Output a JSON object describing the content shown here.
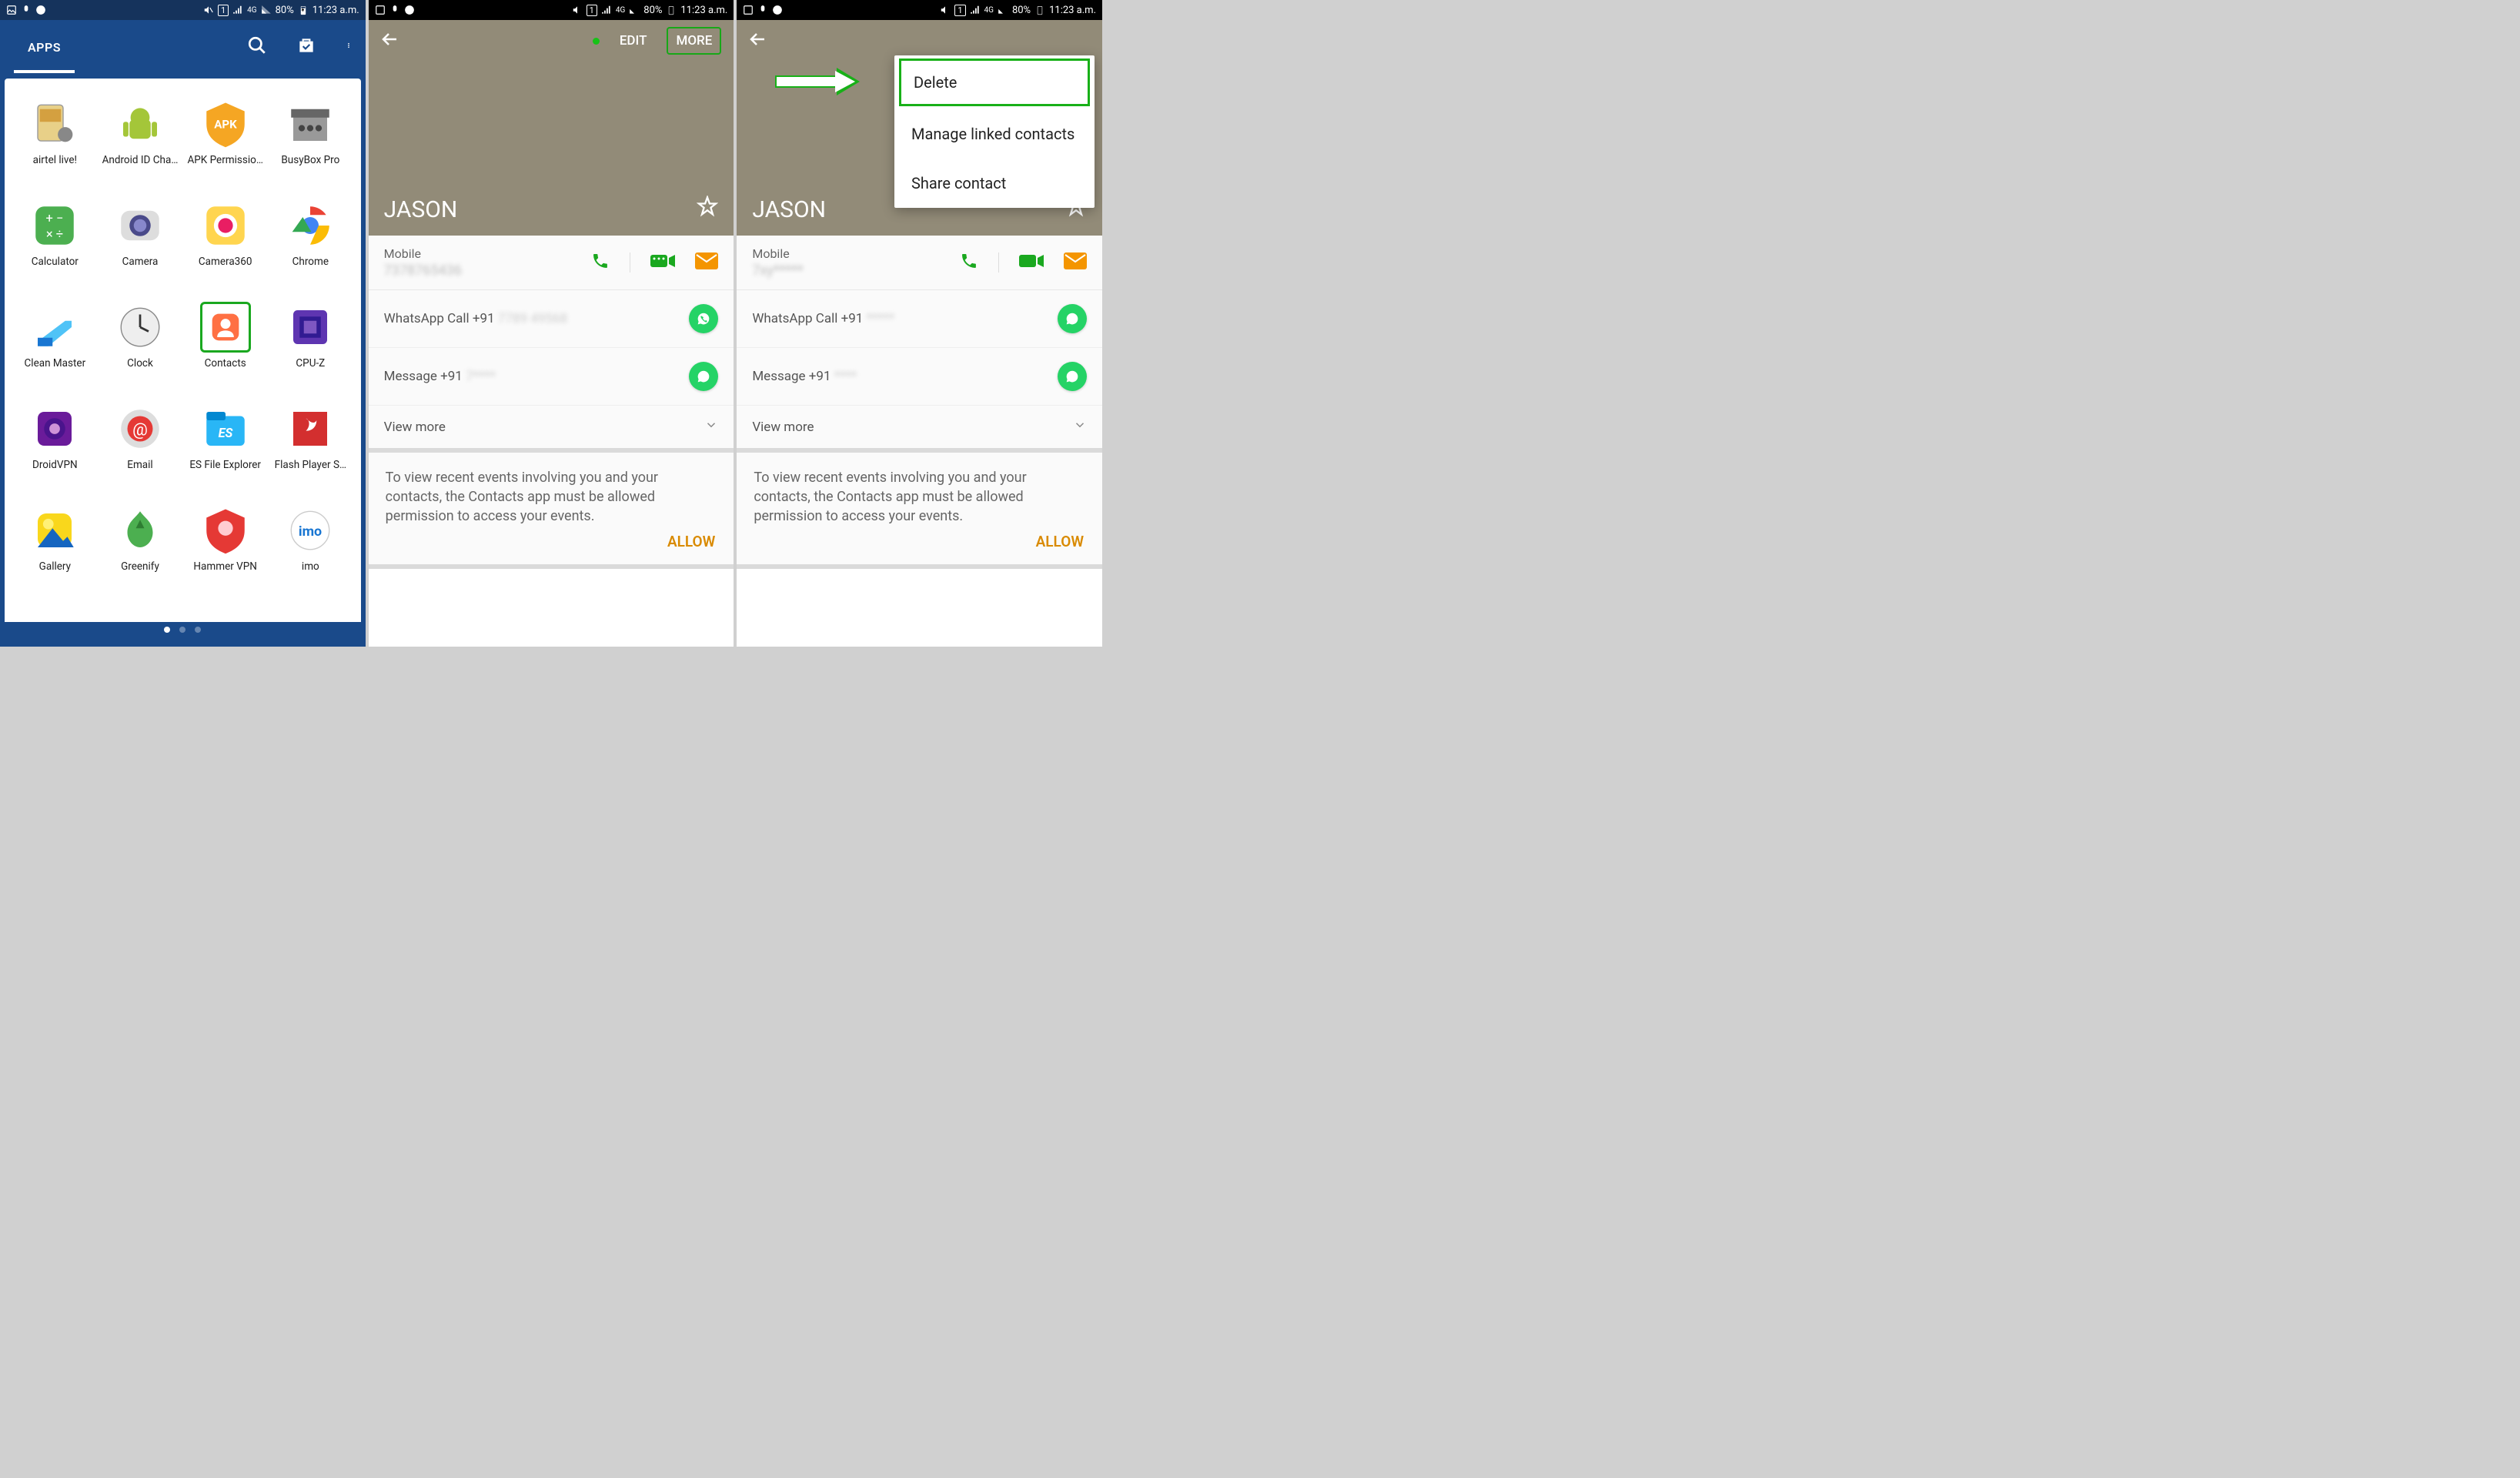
{
  "status": {
    "battery": "80%",
    "time": "11:23 a.m.",
    "network": "4G",
    "sim": "1"
  },
  "drawer": {
    "tab": "APPS",
    "apps": [
      "airtel live!",
      "Android ID Cha…",
      "APK Permissio…",
      "BusyBox Pro",
      "Calculator",
      "Camera",
      "Camera360",
      "Chrome",
      "Clean Master",
      "Clock",
      "Contacts",
      "CPU-Z",
      "DroidVPN",
      "Email",
      "ES File Explorer",
      "Flash Player S…",
      "Gallery",
      "Greenify",
      "Hammer VPN",
      "imo"
    ],
    "highlighted_index": 10
  },
  "contact": {
    "name": "JASON",
    "edit": "EDIT",
    "more": "MORE",
    "mobile_label": "Mobile",
    "whatsapp_call": "WhatsApp Call ",
    "whatsapp_call_prefix": "+91",
    "whatsapp_msg": "Message ",
    "whatsapp_msg_prefix": "+91",
    "view_more": "View more",
    "events_text": "To view recent events involving you and your contacts, the Contacts app must be allowed permission to access your events.",
    "allow": "ALLOW"
  },
  "menu": {
    "delete": "Delete",
    "manage": "Manage linked contacts",
    "share": "Share contact"
  }
}
